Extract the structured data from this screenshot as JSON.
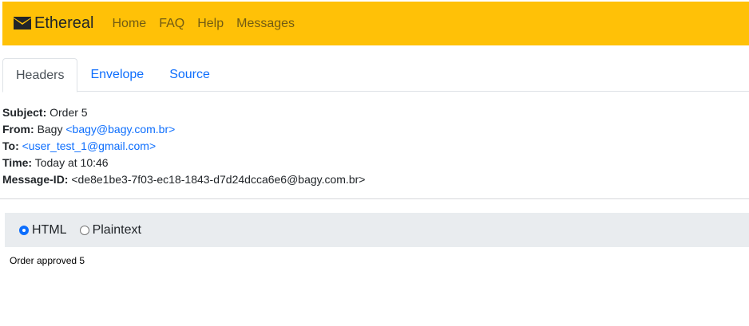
{
  "navbar": {
    "brand": "Ethereal",
    "brand_icon": "envelope-icon",
    "links": [
      "Home",
      "FAQ",
      "Help",
      "Messages"
    ],
    "background": "#ffc107"
  },
  "tabs": {
    "items": [
      "Headers",
      "Envelope",
      "Source"
    ],
    "active": "Headers"
  },
  "headers": {
    "subject_label": "Subject:",
    "subject": "Order 5",
    "from_label": "From:",
    "from_name": "Bagy",
    "from_email": "<bagy@bagy.com.br>",
    "to_label": "To:",
    "to_email": "<user_test_1@gmail.com>",
    "time_label": "Time:",
    "time": "Today at 10:46",
    "message_id_label": "Message-ID:",
    "message_id": "<de8e1be3-7f03-ec18-1843-d7d24dcca6e6@bagy.com.br>"
  },
  "format": {
    "options": [
      "HTML",
      "Plaintext"
    ],
    "selected": "HTML"
  },
  "message_body": "Order approved 5"
}
